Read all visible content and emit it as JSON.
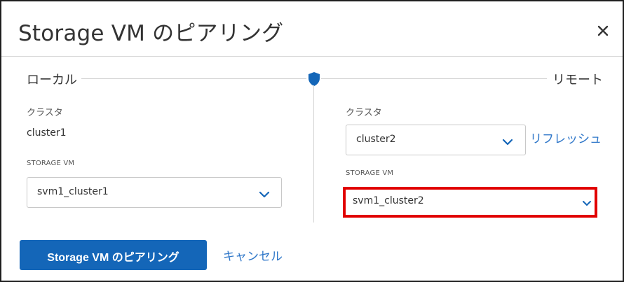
{
  "dialog": {
    "title": "Storage VM のピアリング",
    "close_icon": "close-icon"
  },
  "local": {
    "heading": "ローカル",
    "cluster_label": "クラスタ",
    "cluster_value": "cluster1",
    "svm_label": "STORAGE VM",
    "svm_selected": "svm1_cluster1"
  },
  "remote": {
    "heading": "リモート",
    "cluster_label": "クラスタ",
    "cluster_selected": "cluster2",
    "refresh_link": "リフレッシュ",
    "svm_label": "STORAGE VM",
    "svm_selected": "svm1_cluster2"
  },
  "footer": {
    "primary_label": "Storage VM のピアリング",
    "cancel_label": "キャンセル"
  },
  "colors": {
    "accent": "#1466b8",
    "link": "#2f77c9",
    "highlight": "#e10000"
  }
}
